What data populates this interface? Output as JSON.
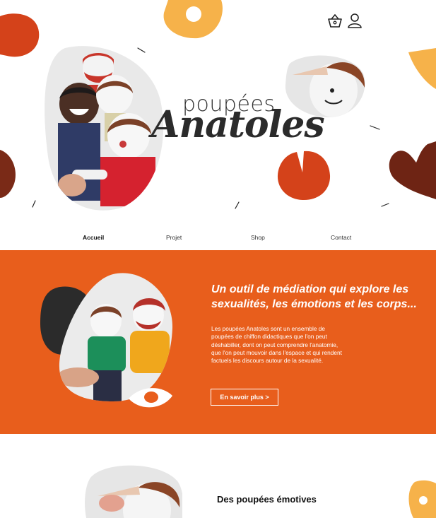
{
  "header": {
    "logo_small": "poupées",
    "logo_big": "Anatoles",
    "cart_icon": "basket-icon",
    "account_icon": "user-icon"
  },
  "nav": {
    "items": [
      {
        "label": "Accueil",
        "active": true
      },
      {
        "label": "Projet",
        "active": false
      },
      {
        "label": "Shop",
        "active": false
      },
      {
        "label": "Contact",
        "active": false
      }
    ]
  },
  "hero": {
    "title": "Un outil de médiation qui explore les sexualités, les émotions et les corps...",
    "text": "Les poupées Anatoles sont un ensemble de poupées de chiffon didactiques que l'on peut déshabiller, dont on peut comprendre l'anatomie, que l'on peut mouvoir dans l'espace et qui rendent factuels les discours autour de la sexualité.",
    "button_label": "En savoir plus >"
  },
  "section2": {
    "title": "Des poupées émotives"
  },
  "colors": {
    "orange": "#e85e1c",
    "yellow": "#f6b24a",
    "rust": "#d4421a",
    "brown": "#6e2414",
    "dark": "#2b2b2b"
  }
}
